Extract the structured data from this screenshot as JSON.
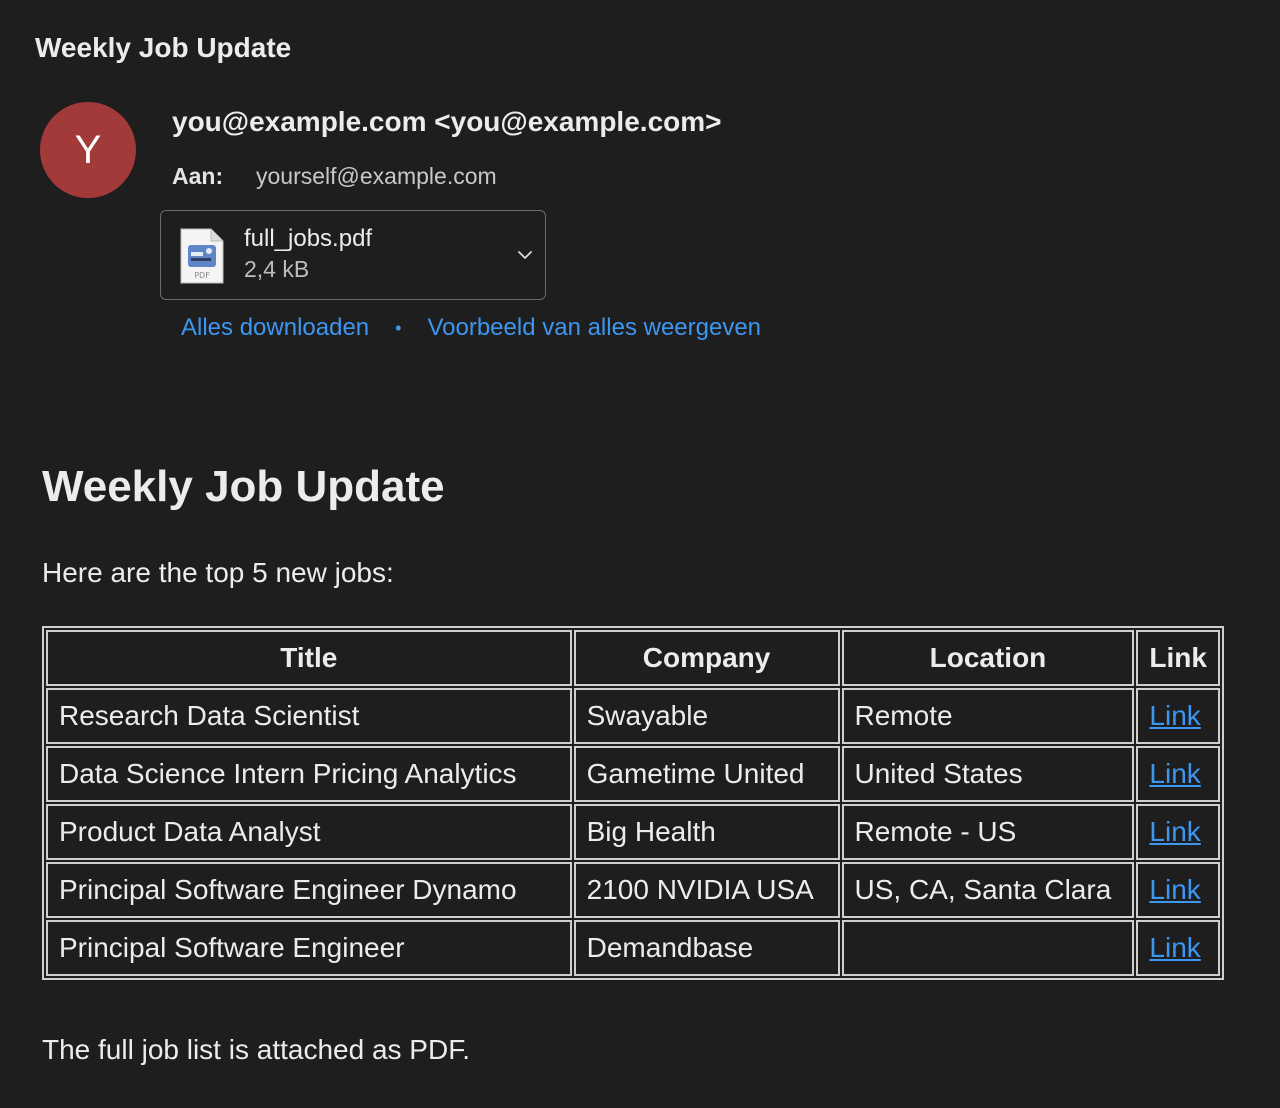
{
  "email": {
    "subject": "Weekly Job Update",
    "avatar_initial": "Y",
    "sender": "you@example.com <you@example.com>",
    "to_label": "Aan:",
    "to_value": "yourself@example.com"
  },
  "attachment": {
    "icon": "pdf-file-icon",
    "icon_caption": "PDF",
    "name": "full_jobs.pdf",
    "size": "2,4 kB",
    "download_all": "Alles downloaden",
    "separator": "•",
    "preview_all": "Voorbeeld van alles weergeven"
  },
  "body": {
    "title": "Weekly Job Update",
    "intro": "Here are the top 5 new jobs:",
    "outro": "The full job list is attached as PDF."
  },
  "table": {
    "headers": [
      "Title",
      "Company",
      "Location",
      "Link"
    ],
    "rows": [
      {
        "title": "Research Data Scientist",
        "company": "Swayable",
        "location": "Remote",
        "link": "Link"
      },
      {
        "title": "Data Science Intern Pricing Analytics",
        "company": "Gametime United",
        "location": "United States",
        "link": "Link"
      },
      {
        "title": "Product Data Analyst",
        "company": "Big Health",
        "location": "Remote - US",
        "link": "Link"
      },
      {
        "title": "Principal Software Engineer Dynamo",
        "company": "2100 NVIDIA USA",
        "location": "US, CA, Santa Clara",
        "link": "Link"
      },
      {
        "title": "Principal Software Engineer",
        "company": "Demandbase",
        "location": "",
        "link": "Link"
      }
    ]
  },
  "colors": {
    "background": "#1e1e1e",
    "avatar": "#a33a3a",
    "link": "#3d96f0"
  }
}
